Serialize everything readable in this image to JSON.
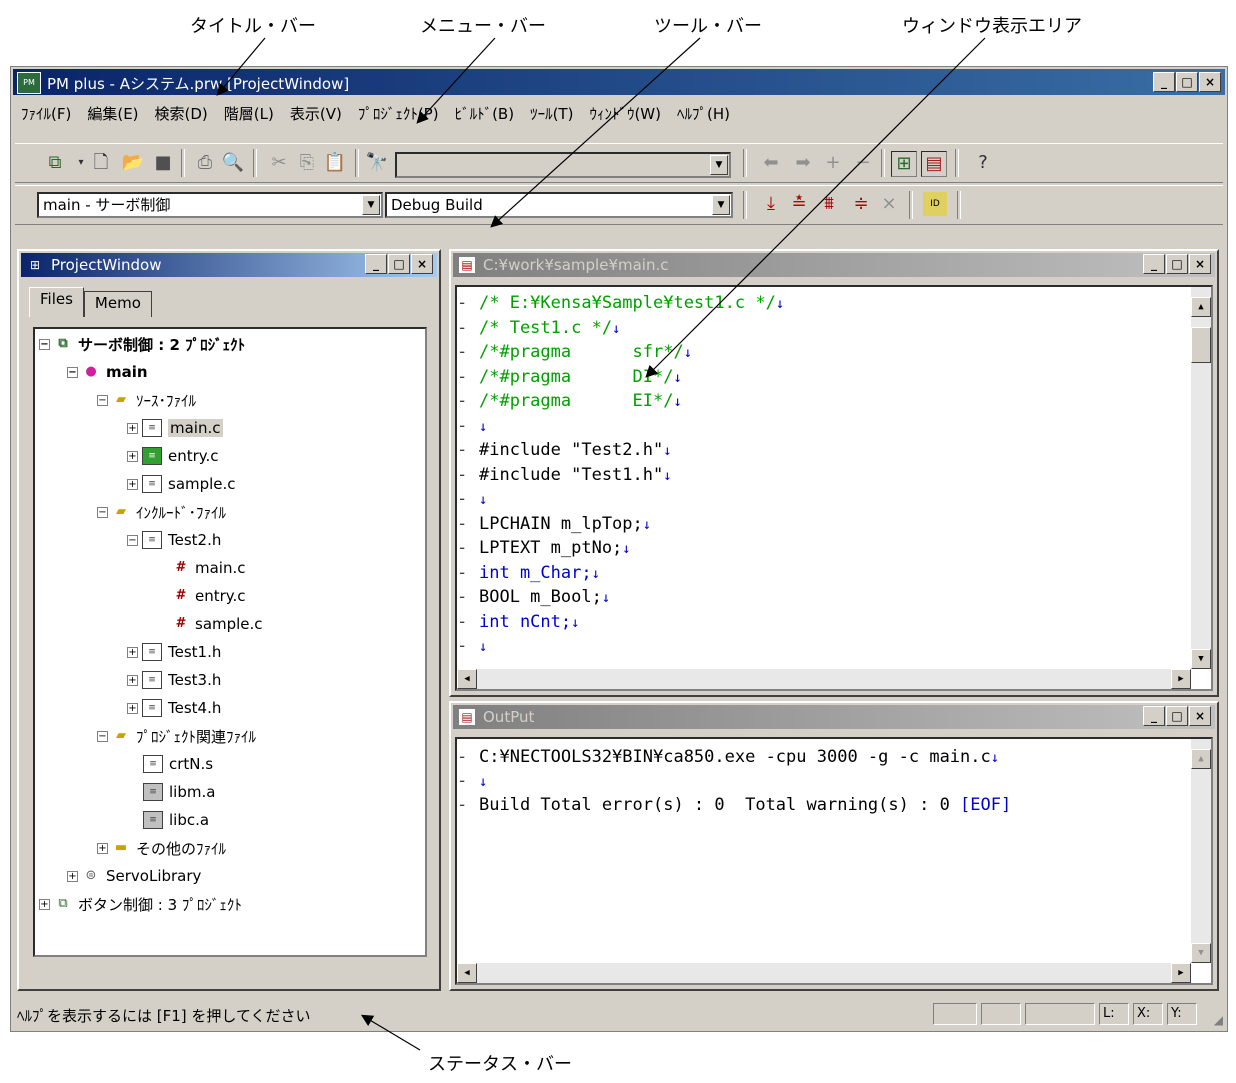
{
  "callouts": {
    "titlebar": "タイトル・バー",
    "menubar": "メニュー・バー",
    "toolbar": "ツール・バー",
    "window_area": "ウィンドウ表示エリア",
    "statusbar": "ステータス・バー"
  },
  "app": {
    "title": "PM plus - Aシステム.prw [ProjectWindow]",
    "icon_text": "PM"
  },
  "menu": [
    "ﾌｧｲﾙ(F)",
    "編集(E)",
    "検索(D)",
    "階層(L)",
    "表示(V)",
    "ﾌﾟﾛｼﾞｪｸﾄ(P)",
    "ﾋﾞﾙﾄﾞ(B)",
    "ﾂｰﾙ(T)",
    "ｳｨﾝﾄﾞｳ(W)",
    "ﾍﾙﾌﾟ(H)"
  ],
  "toolbar2": {
    "project_combo": "main - サーボ制御",
    "build_combo": "Debug Build"
  },
  "project_window": {
    "title": "ProjectWindow",
    "tabs": [
      "Files",
      "Memo"
    ],
    "tree": [
      {
        "label": "サーボ制御 : 2 ﾌﾟﾛｼﾞｪｸﾄ"
      },
      {
        "label": "main"
      },
      {
        "label": "ｿｰｽ･ﾌｧｲﾙ"
      },
      {
        "label": "main.c"
      },
      {
        "label": "entry.c"
      },
      {
        "label": "sample.c"
      },
      {
        "label": "ｲﾝｸﾙｰﾄﾞ･ﾌｧｲﾙ"
      },
      {
        "label": "Test2.h"
      },
      {
        "label": "main.c"
      },
      {
        "label": "entry.c"
      },
      {
        "label": "sample.c"
      },
      {
        "label": "Test1.h"
      },
      {
        "label": "Test3.h"
      },
      {
        "label": "Test4.h"
      },
      {
        "label": "ﾌﾟﾛｼﾞｪｸﾄ関連ﾌｧｲﾙ"
      },
      {
        "label": "crtN.s"
      },
      {
        "label": "libm.a"
      },
      {
        "label": "libc.a"
      },
      {
        "label": "その他のﾌｧｲﾙ"
      },
      {
        "label": "ServoLibrary"
      },
      {
        "label": "ボタン制御 : 3 ﾌﾟﾛｼﾞｪｸﾄ"
      }
    ]
  },
  "editor": {
    "title": "C:¥work¥sample¥main.c",
    "lines": [
      "/* E:¥Kensa¥Sample¥test1.c */",
      "/* Test1.c */",
      "/*#pragma      sfr*/",
      "/*#pragma      DI*/",
      "/*#pragma      EI*/",
      "",
      "#include \"Test2.h\"",
      "#include \"Test1.h\"",
      "",
      "LPCHAIN m_lpTop;",
      "LPTEXT m_ptNo;",
      "int m_Char;",
      "BOOL m_Bool;",
      "int nCnt;",
      ""
    ],
    "newline_mark": "↓"
  },
  "output": {
    "title": "OutPut",
    "lines": [
      "C:¥NECTOOLS32¥BIN¥ca850.exe -cpu 3000 -g -c main.c",
      "",
      "Build Total error(s) : 0  Total warning(s) : 0 "
    ],
    "eof": "[EOF]"
  },
  "status": {
    "text": "ﾍﾙﾌﾟを表示するには [F1] を押してください",
    "l": "L:",
    "x": "X:",
    "y": "Y:"
  }
}
